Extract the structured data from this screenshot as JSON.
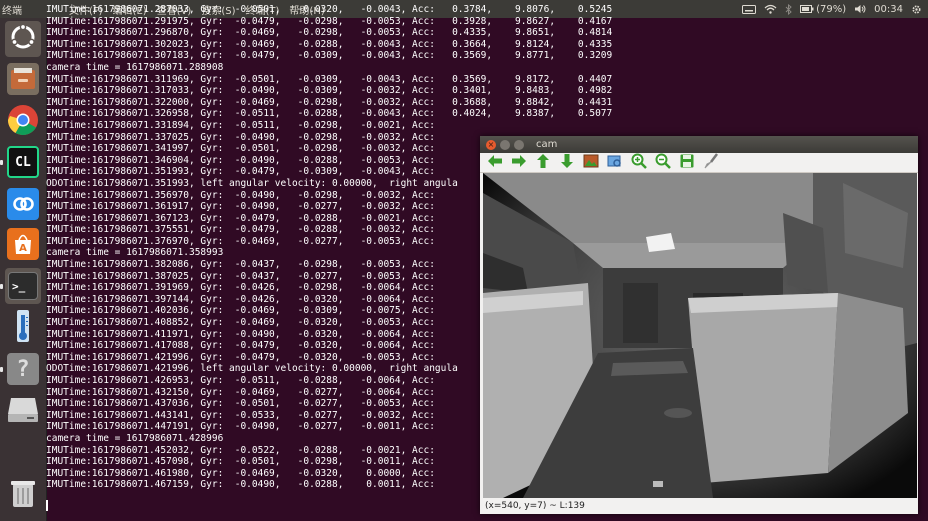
{
  "topbar": {
    "app_title": "终端",
    "menus": [
      "文件(F)",
      "编辑(E)",
      "查看(V)",
      "搜索(S)",
      "终端(T)",
      "帮助(H)"
    ],
    "battery": "(79%)",
    "time": "00:34"
  },
  "launcher": {
    "items": [
      "dash-home-icon",
      "files-icon",
      "chrome-icon",
      "clion-icon",
      "baidu-netdisk-icon",
      "software-center-icon",
      "terminal-icon",
      "thermometer-app-icon",
      "help-unknown-icon",
      "disk-drive-icon",
      "trash-icon"
    ]
  },
  "terminal": {
    "lines": [
      "IMUTime:1617986071.287033, Gyr:  -0.0501,   -0.0320,   -0.0043, Acc:   0.3784,    9.8076,    0.5245",
      "IMUTime:1617986071.291975, Gyr:  -0.0479,   -0.0298,   -0.0053, Acc:   0.3928,    9.8627,    0.4167",
      "IMUTime:1617986071.296870, Gyr:  -0.0469,   -0.0298,   -0.0053, Acc:   0.4335,    9.8651,    0.4814",
      "IMUTime:1617986071.302023, Gyr:  -0.0469,   -0.0288,   -0.0043, Acc:   0.3664,    9.8124,    0.4335",
      "IMUTime:1617986071.307183, Gyr:  -0.0479,   -0.0309,   -0.0043, Acc:   0.3569,    9.8771,    0.3209",
      "camera time = 1617986071.288908",
      "IMUTime:1617986071.311969, Gyr:  -0.0501,   -0.0309,   -0.0043, Acc:   0.3569,    9.8172,    0.4407",
      "IMUTime:1617986071.317033, Gyr:  -0.0490,   -0.0309,   -0.0032, Acc:   0.3401,    9.8483,    0.4982",
      "IMUTime:1617986071.322000, Gyr:  -0.0469,   -0.0298,   -0.0032, Acc:   0.3688,    9.8842,    0.4431",
      "IMUTime:1617986071.326958, Gyr:  -0.0511,   -0.0288,   -0.0043, Acc:   0.4024,    9.8387,    0.5077",
      "IMUTime:1617986071.331894, Gyr:  -0.0511,   -0.0298,   -0.0021, Acc:",
      "IMUTime:1617986071.337025, Gyr:  -0.0490,   -0.0298,   -0.0032, Acc:",
      "IMUTime:1617986071.341997, Gyr:  -0.0501,   -0.0298,   -0.0032, Acc:",
      "IMUTime:1617986071.346904, Gyr:  -0.0490,   -0.0288,   -0.0053, Acc:",
      "IMUTime:1617986071.351993, Gyr:  -0.0479,   -0.0309,   -0.0043, Acc:",
      "ODOTime:1617986071.351993, left angular velocity: 0.00000,  right angula",
      "IMUTime:1617986071.356970, Gyr:  -0.0490,   -0.0298,   -0.0032, Acc:",
      "IMUTime:1617986071.361917, Gyr:  -0.0490,   -0.0277,   -0.0032, Acc:",
      "IMUTime:1617986071.367123, Gyr:  -0.0479,   -0.0288,   -0.0021, Acc:",
      "IMUTime:1617986071.375551, Gyr:  -0.0479,   -0.0288,   -0.0032, Acc:",
      "IMUTime:1617986071.376970, Gyr:  -0.0469,   -0.0277,   -0.0053, Acc:",
      "camera time = 1617986071.358993",
      "IMUTime:1617986071.382086, Gyr:  -0.0437,   -0.0298,   -0.0053, Acc:",
      "IMUTime:1617986071.387025, Gyr:  -0.0437,   -0.0277,   -0.0053, Acc:",
      "IMUTime:1617986071.391969, Gyr:  -0.0426,   -0.0298,   -0.0064, Acc:",
      "IMUTime:1617986071.397144, Gyr:  -0.0426,   -0.0320,   -0.0064, Acc:",
      "IMUTime:1617986071.402036, Gyr:  -0.0469,   -0.0309,   -0.0075, Acc:",
      "IMUTime:1617986071.408852, Gyr:  -0.0469,   -0.0320,   -0.0053, Acc:",
      "IMUTime:1617986071.411971, Gyr:  -0.0490,   -0.0320,   -0.0064, Acc:",
      "IMUTime:1617986071.417088, Gyr:  -0.0479,   -0.0320,   -0.0064, Acc:",
      "IMUTime:1617986071.421996, Gyr:  -0.0479,   -0.0320,   -0.0053, Acc:",
      "ODOTime:1617986071.421996, left angular velocity: 0.00000,  right angula",
      "IMUTime:1617986071.426953, Gyr:  -0.0511,   -0.0288,   -0.0064, Acc:",
      "IMUTime:1617986071.432150, Gyr:  -0.0469,   -0.0277,   -0.0064, Acc:",
      "IMUTime:1617986071.437036, Gyr:  -0.0501,   -0.0277,   -0.0053, Acc:",
      "IMUTime:1617986071.443141, Gyr:  -0.0533,   -0.0277,   -0.0032, Acc:",
      "IMUTime:1617986071.447191, Gyr:  -0.0490,   -0.0277,   -0.0011, Acc:",
      "camera time = 1617986071.428996",
      "IMUTime:1617986071.452032, Gyr:  -0.0522,   -0.0288,   -0.0021, Acc:",
      "IMUTime:1617986071.457098, Gyr:  -0.0501,   -0.0298,   -0.0011, Acc:",
      "IMUTime:1617986071.461980, Gyr:  -0.0469,   -0.0320,    0.0000, Acc:",
      "IMUTime:1617986071.467159, Gyr:  -0.0490,   -0.0288,    0.0011, Acc:"
    ]
  },
  "cam_window": {
    "title": "cam",
    "toolbar_icons": [
      "arrow-left-icon",
      "arrow-right-icon",
      "arrow-up-icon",
      "arrow-down-icon",
      "image-icon",
      "zoom-region-icon",
      "zoom-in-icon",
      "zoom-out-icon",
      "save-icon",
      "settings-brush-icon"
    ],
    "status": "(x=540, y=7) ~ L:139"
  },
  "colors": {
    "terminal_bg": "#300a24",
    "panel_bg": "#3c3b37",
    "launcher_bg": "#3a3234",
    "close_button": "#e75b2e",
    "window_bg": "#f2f1f0"
  }
}
